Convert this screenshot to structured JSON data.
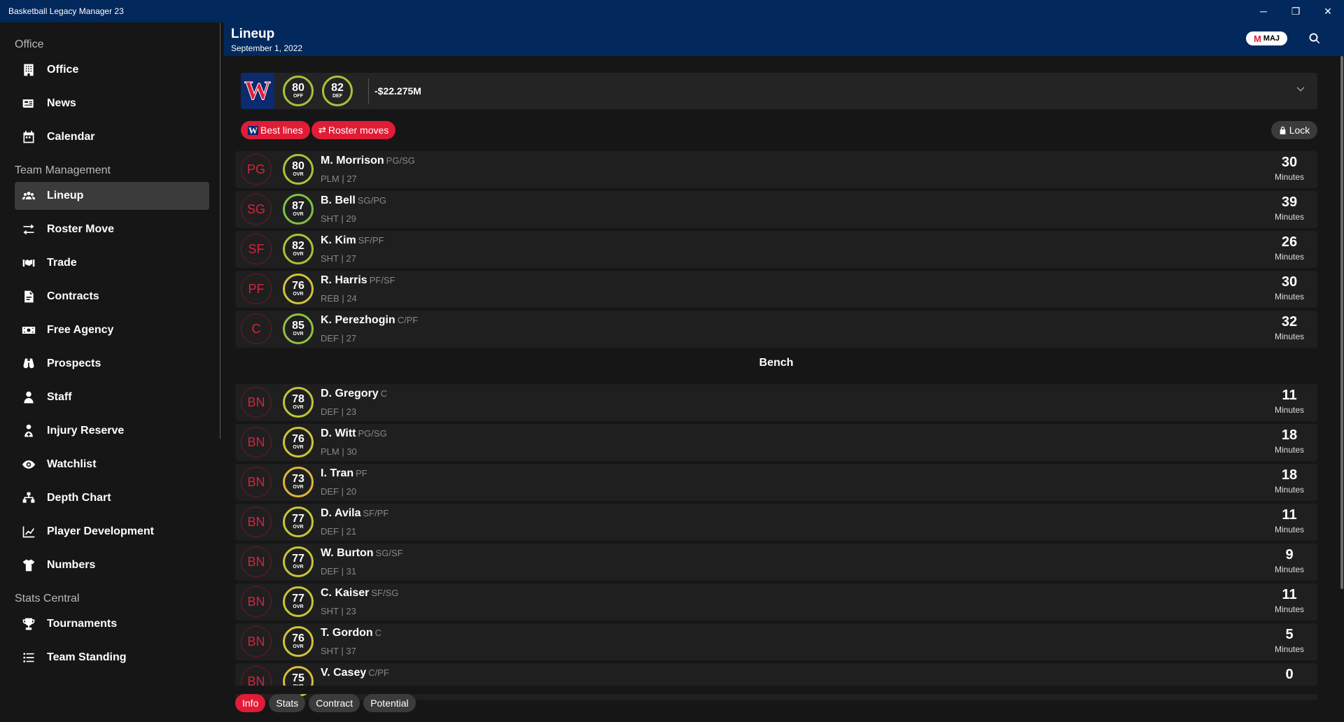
{
  "window": {
    "title": "Basketball Legacy Manager 23",
    "minimize": "─",
    "restore": "❐",
    "close": "✕"
  },
  "sidebar": {
    "sections": [
      {
        "title": "Office",
        "items": [
          {
            "label": "Office",
            "icon": "building-icon"
          },
          {
            "label": "News",
            "icon": "newspaper-icon"
          },
          {
            "label": "Calendar",
            "icon": "calendar-icon"
          }
        ]
      },
      {
        "title": "Team Management",
        "items": [
          {
            "label": "Lineup",
            "icon": "users-icon",
            "active": true
          },
          {
            "label": "Roster Move",
            "icon": "swap-icon"
          },
          {
            "label": "Trade",
            "icon": "trade-icon"
          },
          {
            "label": "Contracts",
            "icon": "contract-icon"
          },
          {
            "label": "Free Agency",
            "icon": "money-icon"
          },
          {
            "label": "Prospects",
            "icon": "binoculars-icon"
          },
          {
            "label": "Staff",
            "icon": "staff-icon"
          },
          {
            "label": "Injury Reserve",
            "icon": "injury-icon"
          },
          {
            "label": "Watchlist",
            "icon": "eye-icon"
          },
          {
            "label": "Depth Chart",
            "icon": "sitemap-icon"
          },
          {
            "label": "Player Development",
            "icon": "chart-line-icon"
          },
          {
            "label": "Numbers",
            "icon": "shirt-icon"
          }
        ]
      },
      {
        "title": "Stats Central",
        "items": [
          {
            "label": "Tournaments",
            "icon": "trophy-icon"
          },
          {
            "label": "Team Standing",
            "icon": "list-icon"
          }
        ]
      }
    ]
  },
  "header": {
    "title": "Lineup",
    "date": "September 1, 2022",
    "badge_letter": "M",
    "badge_text": "MAJ"
  },
  "team": {
    "logo_letter": "W",
    "off": "80",
    "off_label": "OFF",
    "def": "82",
    "def_label": "DEF",
    "money": "-$22.275M"
  },
  "actions": {
    "best_lines": "Best lines",
    "roster_moves": "Roster moves",
    "lock": "Lock"
  },
  "bench_title": "Bench",
  "ovr_label": "OVR",
  "minutes_label": "Minutes",
  "starters": [
    {
      "pos": "PG",
      "ovr": "80",
      "name": "M. Morrison",
      "pos2": "PG/SG",
      "meta": "PLM | 27",
      "minutes": "30",
      "color": "#a6c43a"
    },
    {
      "pos": "SG",
      "ovr": "87",
      "name": "B. Bell",
      "pos2": "SG/PG",
      "meta": "SHT | 29",
      "minutes": "39",
      "color": "#7fc241"
    },
    {
      "pos": "SF",
      "ovr": "82",
      "name": "K. Kim",
      "pos2": "SF/PF",
      "meta": "SHT | 27",
      "minutes": "26",
      "color": "#a6c43a"
    },
    {
      "pos": "PF",
      "ovr": "76",
      "name": "R. Harris",
      "pos2": "PF/SF",
      "meta": "REB | 24",
      "minutes": "30",
      "color": "#cfc43a"
    },
    {
      "pos": "C",
      "ovr": "85",
      "name": "K. Perezhogin",
      "pos2": "C/PF",
      "meta": "DEF | 27",
      "minutes": "32",
      "color": "#90c23e"
    }
  ],
  "bench": [
    {
      "pos": "BN",
      "ovr": "78",
      "name": "D. Gregory",
      "pos2": "C",
      "meta": "DEF | 23",
      "minutes": "11",
      "color": "#c2c43a"
    },
    {
      "pos": "BN",
      "ovr": "76",
      "name": "D. Witt",
      "pos2": "PG/SG",
      "meta": "PLM | 30",
      "minutes": "18",
      "color": "#cfc43a"
    },
    {
      "pos": "BN",
      "ovr": "73",
      "name": "I. Tran",
      "pos2": "PF",
      "meta": "DEF | 20",
      "minutes": "18",
      "color": "#e0b53a"
    },
    {
      "pos": "BN",
      "ovr": "77",
      "name": "D. Avila",
      "pos2": "SF/PF",
      "meta": "DEF | 21",
      "minutes": "11",
      "color": "#c8c43a"
    },
    {
      "pos": "BN",
      "ovr": "77",
      "name": "W. Burton",
      "pos2": "SG/SF",
      "meta": "DEF | 31",
      "minutes": "9",
      "color": "#c8c43a"
    },
    {
      "pos": "BN",
      "ovr": "77",
      "name": "C. Kaiser",
      "pos2": "SF/SG",
      "meta": "SHT | 23",
      "minutes": "11",
      "color": "#c8c43a"
    },
    {
      "pos": "BN",
      "ovr": "76",
      "name": "T. Gordon",
      "pos2": "C",
      "meta": "SHT | 37",
      "minutes": "5",
      "color": "#cfc43a"
    },
    {
      "pos": "BN",
      "ovr": "75",
      "name": "V. Casey",
      "pos2": "C/PF",
      "meta": "",
      "minutes": "0",
      "color": "#d6bd3a"
    }
  ],
  "tabs": [
    {
      "label": "Info",
      "active": true
    },
    {
      "label": "Stats"
    },
    {
      "label": "Contract"
    },
    {
      "label": "Potential"
    }
  ],
  "colors": {
    "accent": "#e01c36",
    "header_blue": "#03285c"
  }
}
